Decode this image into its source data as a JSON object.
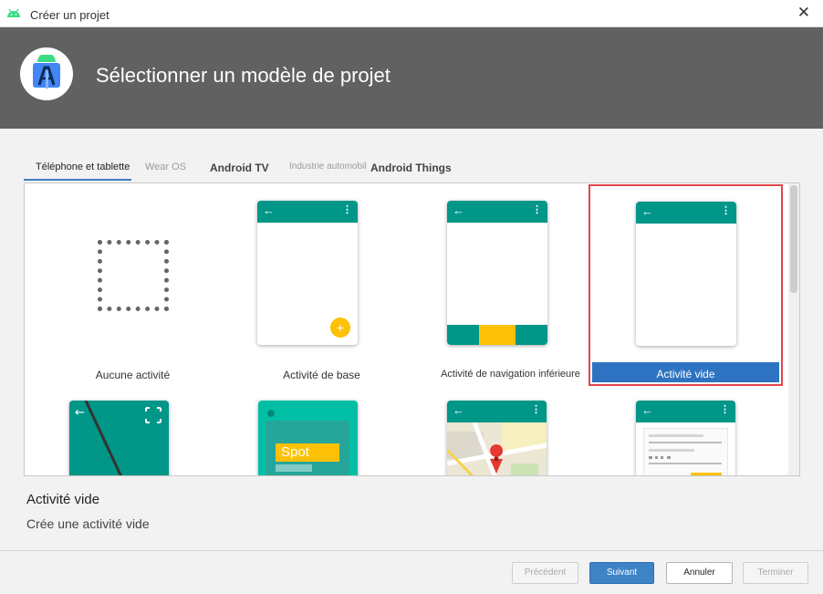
{
  "window": {
    "title": "Créer un projet",
    "close_glyph": "✕",
    "app_icon": "android-icon"
  },
  "header": {
    "title": "Sélectionner un modèle de projet",
    "logo": "android-studio-logo"
  },
  "tabs": [
    {
      "label": "Téléphone et tablette",
      "active": true
    },
    {
      "label": "Wear OS"
    },
    {
      "label": "Android TV"
    },
    {
      "label": "Industrie automobil"
    },
    {
      "label": "Android Things"
    }
  ],
  "templates": [
    {
      "label": "Aucune activité"
    },
    {
      "label": "Activité de base"
    },
    {
      "label": "Activité de navigation inférieure"
    },
    {
      "label": "Activité vide",
      "selected": true
    }
  ],
  "second_row": {
    "spot_text": "Spot"
  },
  "phone": {
    "back_glyph": "←",
    "menu_glyph": "⋮",
    "fab_glyph": "+"
  },
  "description": {
    "title": "Activité vide",
    "text": "Crée une activité vide"
  },
  "buttons": {
    "previous": "Précédent",
    "next": "Suivant",
    "cancel": "Annuler",
    "finish": "Terminer"
  },
  "colors": {
    "accent": "#009688",
    "selection": "#2e73c1",
    "selection_border": "#e0464a",
    "fab": "#ffc107",
    "header_bg": "#616161"
  }
}
